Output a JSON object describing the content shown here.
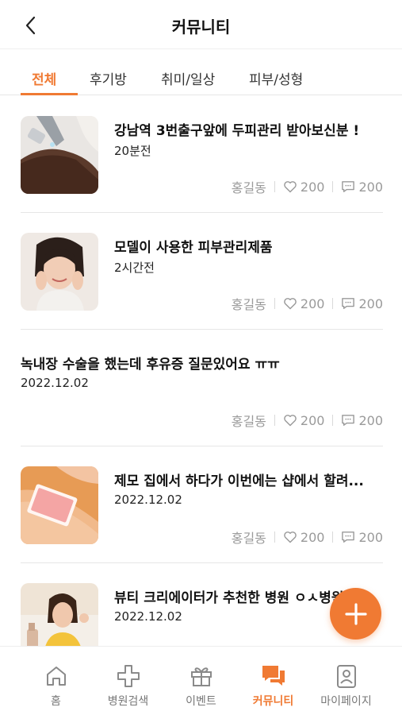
{
  "header": {
    "title": "커뮤니티"
  },
  "tabs": [
    {
      "label": "전체"
    },
    {
      "label": "후기방"
    },
    {
      "label": "취미/일상"
    },
    {
      "label": "피부/성형"
    }
  ],
  "active_tab": "전체",
  "posts": [
    {
      "title": "강남역 3번출구앞에 두피관리 받아보신분 !",
      "time": "20분전",
      "author": "홍길동",
      "likes": "200",
      "comments": "200",
      "thumbnail": "scalp-care-photo"
    },
    {
      "title": "모델이 사용한 피부관리제품",
      "time": "2시간전",
      "author": "홍길동",
      "likes": "200",
      "comments": "200",
      "thumbnail": "model-face-photo"
    },
    {
      "title": "녹내장 수술을 했는데 후유증 질문있어요 ㅠㅠ",
      "time": "2022.12.02",
      "author": "홍길동",
      "likes": "200",
      "comments": "200",
      "thumbnail": ""
    },
    {
      "title": "제모 집에서 하다가 이번에는 샵에서 할려...",
      "time": "2022.12.02",
      "author": "홍길동",
      "likes": "200",
      "comments": "200",
      "thumbnail": "waxing-photo"
    },
    {
      "title": "뷰티 크리에이터가 추천한 병원 ㅇㅅ병원",
      "time": "2022.12.02",
      "author": "",
      "likes": "",
      "comments": "",
      "thumbnail": "beauty-creator-photo"
    }
  ],
  "fab": {
    "icon": "plus-icon"
  },
  "bottom_nav": [
    {
      "label": "홈",
      "icon": "home-icon"
    },
    {
      "label": "병원검색",
      "icon": "medical-cross-icon"
    },
    {
      "label": "이벤트",
      "icon": "gift-icon"
    },
    {
      "label": "커뮤니티",
      "icon": "chat-bubbles-icon"
    },
    {
      "label": "마이페이지",
      "icon": "profile-card-icon"
    }
  ],
  "active_nav": "커뮤니티",
  "colors": {
    "accent": "#f07a33",
    "muted": "#9a9a9a",
    "divider": "#e6e6e6"
  }
}
